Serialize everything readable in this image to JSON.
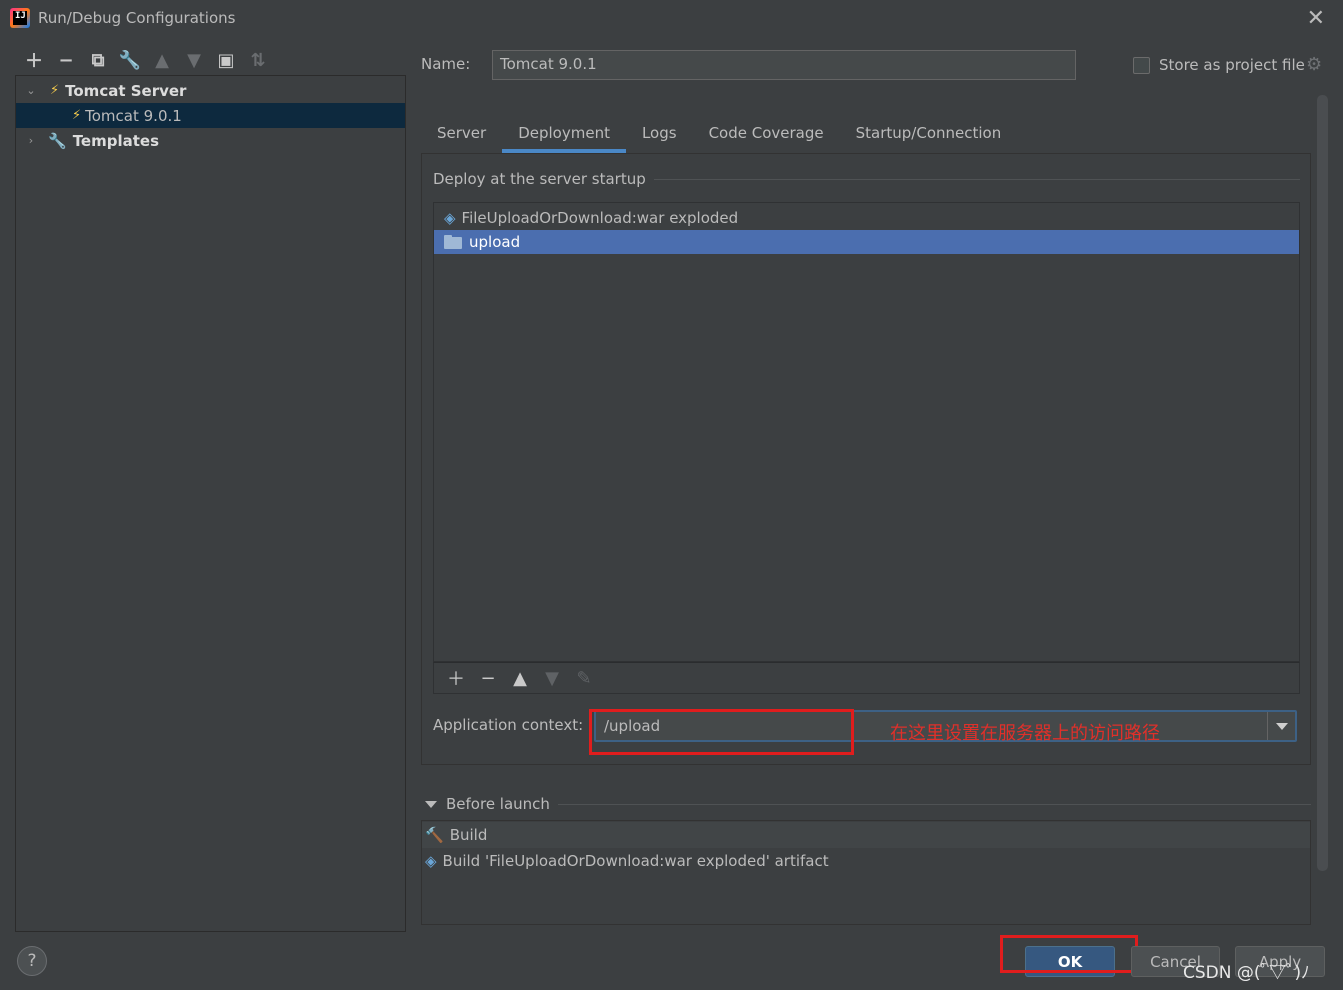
{
  "window": {
    "title": "Run/Debug Configurations",
    "app_icon": "intellij-idea-icon"
  },
  "toolbar": {
    "buttons": [
      "add",
      "remove",
      "copy",
      "edit-templates",
      "move-up",
      "move-down",
      "new-folder",
      "sort"
    ]
  },
  "tree": {
    "group_label": "Tomcat Server",
    "selected_config": "Tomcat 9.0.1",
    "templates_label": "Templates"
  },
  "name_field": {
    "label": "Name:",
    "value": "Tomcat 9.0.1"
  },
  "store_as_project_file": {
    "label": "Store as project file",
    "checked": false
  },
  "tabs": [
    {
      "label": "Server",
      "active": false
    },
    {
      "label": "Deployment",
      "active": true
    },
    {
      "label": "Logs",
      "active": false
    },
    {
      "label": "Code Coverage",
      "active": false
    },
    {
      "label": "Startup/Connection",
      "active": false
    }
  ],
  "deployment": {
    "section_title": "Deploy at the server startup",
    "items": [
      {
        "label": "FileUploadOrDownload:war exploded",
        "icon": "artifact-icon",
        "selected": false
      },
      {
        "label": "upload",
        "icon": "folder-icon",
        "selected": true
      }
    ],
    "list_toolbar": [
      "add",
      "remove",
      "move-up",
      "move-down",
      "edit"
    ]
  },
  "app_context": {
    "label": "Application context:",
    "value": "/upload",
    "annotation": "在这里设置在服务器上的访问路径"
  },
  "before_launch": {
    "title": "Before launch",
    "items": [
      {
        "label": "Build",
        "icon": "hammer-icon"
      },
      {
        "label": "Build 'FileUploadOrDownload:war exploded' artifact",
        "icon": "artifact-icon"
      }
    ]
  },
  "buttons": {
    "help": "?",
    "ok": "OK",
    "cancel": "Cancel",
    "apply": "Apply"
  },
  "watermark": "CSDN @(ﾟ▽ﾟ)ﾉ",
  "colors": {
    "background": "#3c3f41",
    "selection": "#4b6eaf",
    "tree_selection": "#0d293e",
    "annotation_red": "#e01d1d",
    "ok_button": "#365880"
  }
}
